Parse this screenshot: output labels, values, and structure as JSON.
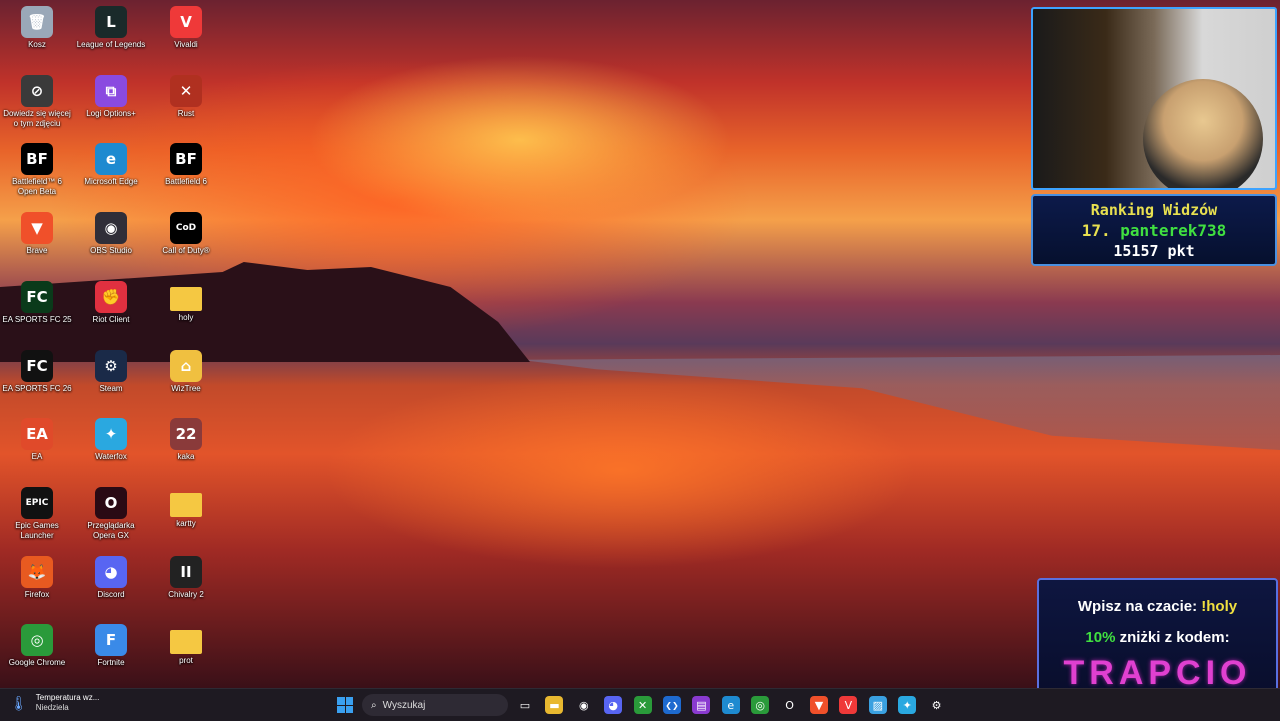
{
  "desktop": {
    "icons": [
      {
        "label": "Kosz",
        "name": "recycle-bin-icon",
        "col": 1,
        "glyph": "🗑",
        "bg": "#9aa8b8"
      },
      {
        "label": "League of Legends",
        "name": "league-of-legends-icon",
        "col": 2,
        "glyph": "L",
        "bg": "#1a2a2a"
      },
      {
        "label": "Vivaldi",
        "name": "vivaldi-icon",
        "col": 3,
        "glyph": "V",
        "bg": "#ef3939"
      },
      {
        "label": "Dowiedz się więcej o tym zdjęciu",
        "name": "learn-about-photo-icon",
        "col": 1,
        "glyph": "⊘",
        "bg": "#3a3a3a"
      },
      {
        "label": "Logi Options+",
        "name": "logi-options-icon",
        "col": 2,
        "glyph": "⧉",
        "bg": "#8a4ae0"
      },
      {
        "label": "Rust",
        "name": "rust-icon",
        "col": 3,
        "glyph": "✕",
        "bg": "#b03020"
      },
      {
        "label": "Battlefield™ 6 Open Beta",
        "name": "battlefield-beta-icon",
        "col": 1,
        "glyph": "BF",
        "bg": "#000000"
      },
      {
        "label": "Microsoft Edge",
        "name": "edge-icon",
        "col": 2,
        "glyph": "e",
        "bg": "#1e8ad0"
      },
      {
        "label": "Battlefield 6",
        "name": "battlefield-6-icon",
        "col": 3,
        "glyph": "BF",
        "bg": "#000000"
      },
      {
        "label": "Brave",
        "name": "brave-icon",
        "col": 1,
        "glyph": "▼",
        "bg": "#f0502a"
      },
      {
        "label": "OBS Studio",
        "name": "obs-icon",
        "col": 2,
        "glyph": "◉",
        "bg": "#302e38"
      },
      {
        "label": "Call of Duty®",
        "name": "call-of-duty-icon",
        "col": 3,
        "glyph": "CoD",
        "bg": "#000000"
      },
      {
        "label": "EA SPORTS FC 25",
        "name": "ea-fc25-icon",
        "col": 1,
        "glyph": "FC",
        "bg": "#0a3a1a"
      },
      {
        "label": "Riot Client",
        "name": "riot-client-icon",
        "col": 2,
        "glyph": "✊",
        "bg": "#e03040"
      },
      {
        "label": "holy",
        "name": "folder-holy-icon",
        "col": 3,
        "glyph": "",
        "bg": "#f5c842"
      },
      {
        "label": "EA SPORTS FC 26",
        "name": "ea-fc26-icon",
        "col": 1,
        "glyph": "FC",
        "bg": "#111111"
      },
      {
        "label": "Steam",
        "name": "steam-icon",
        "col": 2,
        "glyph": "⚙",
        "bg": "#1a2a48"
      },
      {
        "label": "WizTree",
        "name": "wiztree-icon",
        "col": 3,
        "glyph": "⌂",
        "bg": "#f0c040"
      },
      {
        "label": "EA",
        "name": "ea-icon",
        "col": 1,
        "glyph": "EA",
        "bg": "#e04a2a"
      },
      {
        "label": "Waterfox",
        "name": "waterfox-icon",
        "col": 2,
        "glyph": "✦",
        "bg": "#2aa8e0"
      },
      {
        "label": "kaka",
        "name": "kaka-icon",
        "col": 3,
        "glyph": "22",
        "bg": "#8a3a3a"
      },
      {
        "label": "Epic Games Launcher",
        "name": "epic-games-icon",
        "col": 1,
        "glyph": "EPIC",
        "bg": "#111111"
      },
      {
        "label": "Przeglądarka Opera GX",
        "name": "opera-gx-icon",
        "col": 2,
        "glyph": "O",
        "bg": "#2a0a14"
      },
      {
        "label": "kartty",
        "name": "folder-kartty-icon",
        "col": 3,
        "glyph": "",
        "bg": "#f5c842"
      },
      {
        "label": "Firefox",
        "name": "firefox-icon",
        "col": 1,
        "glyph": "🦊",
        "bg": "#e85a20"
      },
      {
        "label": "Discord",
        "name": "discord-icon",
        "col": 2,
        "glyph": "◕",
        "bg": "#5865f2"
      },
      {
        "label": "Chivalry 2",
        "name": "chivalry-2-icon",
        "col": 3,
        "glyph": "II",
        "bg": "#222222"
      },
      {
        "label": "Google Chrome",
        "name": "chrome-icon",
        "col": 1,
        "glyph": "◎",
        "bg": "#2a9a3a"
      },
      {
        "label": "Fortnite",
        "name": "fortnite-icon",
        "col": 2,
        "glyph": "F",
        "bg": "#3a8ae8"
      },
      {
        "label": "prot",
        "name": "folder-prot-icon",
        "col": 3,
        "glyph": "",
        "bg": "#f5c842"
      }
    ]
  },
  "overlay": {
    "ranking": {
      "title": "Ranking Widzów",
      "position": "17.",
      "username": "panterek738",
      "points": "15157 pkt"
    },
    "promo": {
      "line1_prefix": "Wpisz na czacie: ",
      "line1_command": "!holy",
      "line2_percent": "10%",
      "line2_suffix": " zniżki z kodem:",
      "code": "TRAPCIO"
    }
  },
  "taskbar": {
    "weather_title": "Temperatura wz...",
    "weather_subtitle": "Niedziela",
    "search_placeholder": "Wyszukaj",
    "apps": [
      {
        "name": "task-view-icon",
        "glyph": "▭",
        "bg": "transparent"
      },
      {
        "name": "file-explorer-icon",
        "glyph": "▬",
        "bg": "#e8b830"
      },
      {
        "name": "obs-taskbar-icon",
        "glyph": "◉",
        "bg": "transparent"
      },
      {
        "name": "discord-taskbar-icon",
        "glyph": "◕",
        "bg": "#5865f2"
      },
      {
        "name": "xbox-taskbar-icon",
        "glyph": "✕",
        "bg": "#2a9a3a"
      },
      {
        "name": "vscode-taskbar-icon",
        "glyph": "❮❯",
        "bg": "#1e6ad0"
      },
      {
        "name": "app-purple-taskbar-icon",
        "glyph": "▤",
        "bg": "#8a3ad0"
      },
      {
        "name": "edge-taskbar-icon",
        "glyph": "e",
        "bg": "#1e8ad0"
      },
      {
        "name": "chrome-taskbar-icon",
        "glyph": "◎",
        "bg": "#2a9a3a"
      },
      {
        "name": "opera-taskbar-icon",
        "glyph": "O",
        "bg": "transparent"
      },
      {
        "name": "brave-taskbar-icon",
        "glyph": "▼",
        "bg": "#f0502a"
      },
      {
        "name": "vivaldi-taskbar-icon",
        "glyph": "V",
        "bg": "#ef3939"
      },
      {
        "name": "photos-taskbar-icon",
        "glyph": "▨",
        "bg": "#3aa0e0"
      },
      {
        "name": "waterfox-taskbar-icon",
        "glyph": "✦",
        "bg": "#2aa8e0"
      },
      {
        "name": "settings-taskbar-icon",
        "glyph": "⚙",
        "bg": "transparent"
      }
    ]
  }
}
